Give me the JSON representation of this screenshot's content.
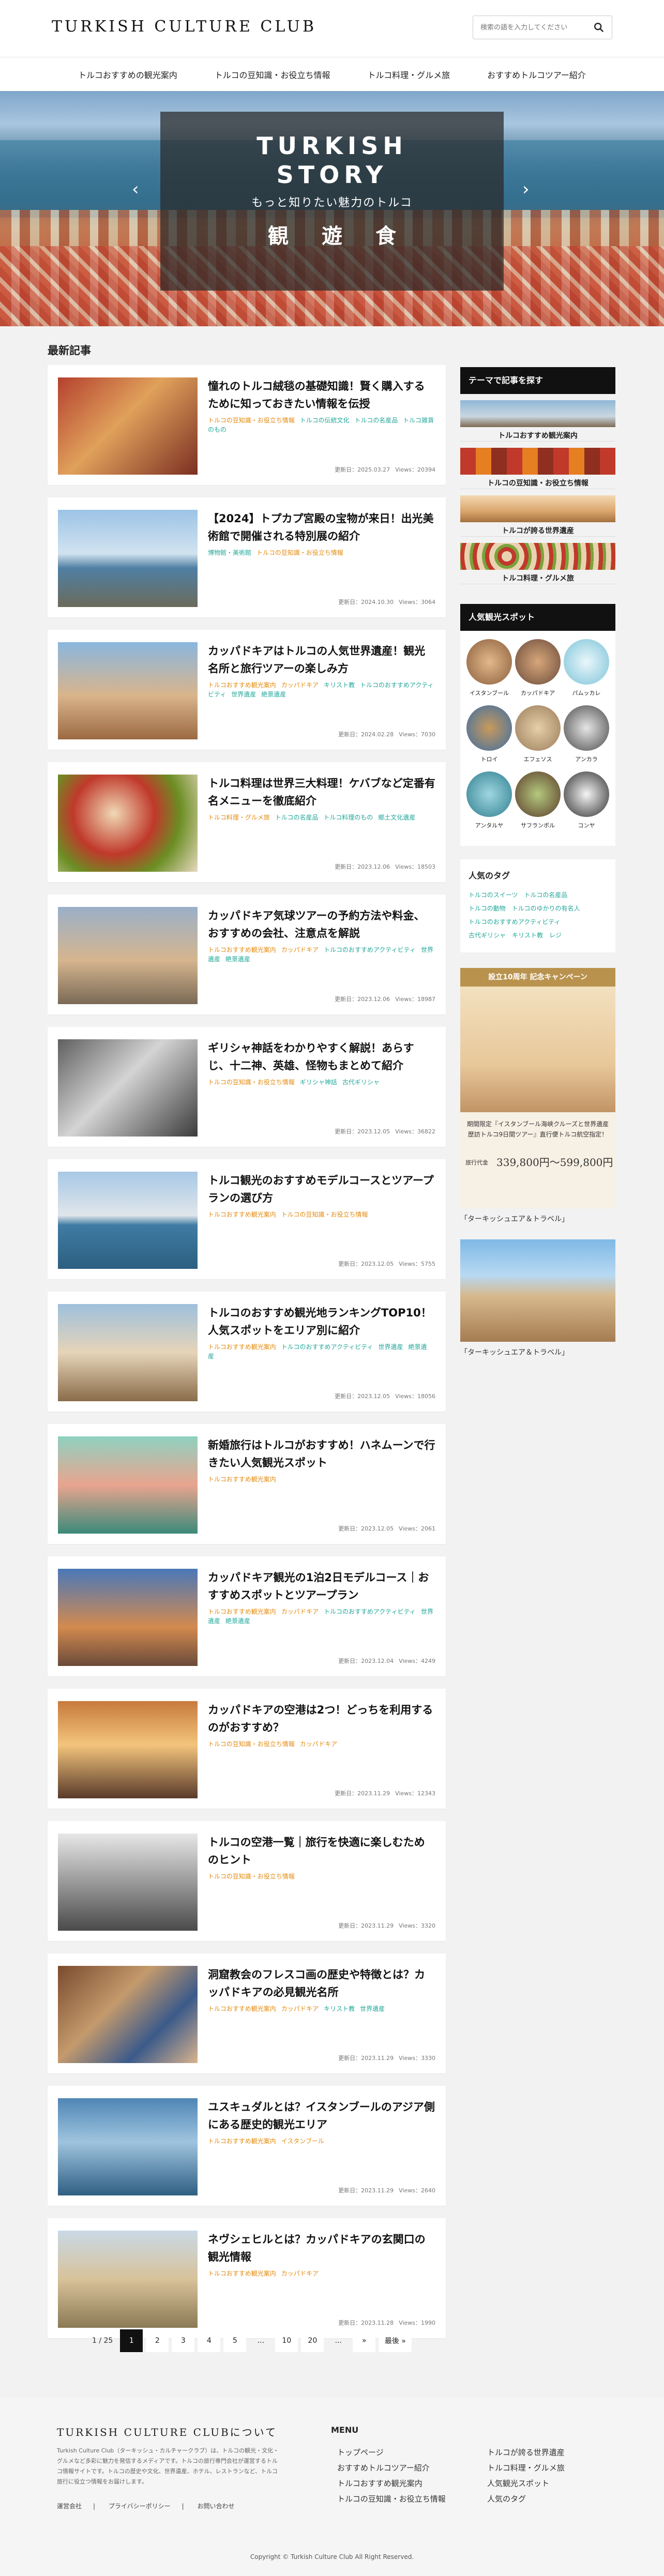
{
  "header": {
    "logo": "TURKISH CULTURE CLUB",
    "search_placeholder": "検索の語を入力してください"
  },
  "nav": [
    "トルコおすすめの観光案内",
    "トルコの豆知識・お役立ち情報",
    "トルコ料理・グルメ旅",
    "おすすめトルコツアー紹介"
  ],
  "hero": {
    "title_line1": "TURKISH",
    "title_line2": "STORY",
    "subtitle": "もっと知りたい魅力のトルコ",
    "kanji": "観遊食"
  },
  "section_title": "最新記事",
  "articles": [
    {
      "title": "憧れのトルコ絨毯の基礎知識！賢く購入するために知っておきたい情報を伝授",
      "cats_orange": [
        "トルコの豆知識・お役立ち情報"
      ],
      "cats_teal": [
        "トルコの伝統文化",
        "トルコの名産品",
        "トルコ雑貨のもの"
      ],
      "date": "2025.03.27",
      "views": "20394"
    },
    {
      "title": "【2024】トプカプ宮殿の宝物が来日！出光美術館で開催される特別展の紹介",
      "cats_orange": [],
      "cats_teal": [
        "博物館・美術館"
      ],
      "cats_orange2": [
        "トルコの豆知識・お役立ち情報"
      ],
      "date": "2024.10.30",
      "views": "3064"
    },
    {
      "title": "カッパドキアはトルコの人気世界遺産！観光名所と旅行ツアーの楽しみ方",
      "cats_orange": [
        "トルコおすすめ観光案内",
        "カッパドキア"
      ],
      "cats_teal": [
        "キリスト教",
        "トルコのおすすめアクティビティ",
        "世界遺産",
        "絶景遺産"
      ],
      "date": "2024.02.28",
      "views": "7030"
    },
    {
      "title": "トルコ料理は世界三大料理！ケバブなど定番有名メニューを徹底紹介",
      "cats_orange": [
        "トルコ料理・グルメ旅"
      ],
      "cats_teal": [
        "トルコの名産品",
        "トルコ料理のもの",
        "郷土文化遺産"
      ],
      "date": "2023.12.06",
      "views": "18503"
    },
    {
      "title": "カッパドキア気球ツアーの予約方法や料金、おすすめの会社、注意点を解説",
      "cats_orange": [
        "トルコおすすめ観光案内",
        "カッパドキア"
      ],
      "cats_teal": [
        "トルコのおすすめアクティビティ",
        "世界遺産",
        "絶景遺産"
      ],
      "date": "2023.12.06",
      "views": "18987"
    },
    {
      "title": "ギリシャ神話をわかりやすく解説！あらすじ、十二神、英雄、怪物もまとめて紹介",
      "cats_orange": [
        "トルコの豆知識・お役立ち情報"
      ],
      "cats_teal": [
        "ギリシャ神話",
        "古代ギリシャ"
      ],
      "date": "2023.12.05",
      "views": "36822"
    },
    {
      "title": "トルコ観光のおすすめモデルコースとツアープランの選び方",
      "cats_orange": [
        "トルコおすすめ観光案内",
        "トルコの豆知識・お役立ち情報"
      ],
      "cats_teal": [],
      "date": "2023.12.05",
      "views": "5755"
    },
    {
      "title": "トルコのおすすめ観光地ランキングTOP10！人気スポットをエリア別に紹介",
      "cats_orange": [
        "トルコおすすめ観光案内"
      ],
      "cats_teal": [
        "トルコのおすすめアクティビティ",
        "世界遺産",
        "絶景遺産"
      ],
      "date": "2023.12.05",
      "views": "18056"
    },
    {
      "title": "新婚旅行はトルコがおすすめ！ハネムーンで行きたい人気観光スポット",
      "cats_orange": [
        "トルコおすすめ観光案内"
      ],
      "cats_teal": [],
      "date": "2023.12.05",
      "views": "2061"
    },
    {
      "title": "カッパドキア観光の1泊2日モデルコース｜おすすめスポットとツアープラン",
      "cats_orange": [
        "トルコおすすめ観光案内",
        "カッパドキア"
      ],
      "cats_teal": [
        "トルコのおすすめアクティビティ",
        "世界遺産",
        "絶景遺産"
      ],
      "date": "2023.12.04",
      "views": "4249"
    },
    {
      "title": "カッパドキアの空港は2つ！どっちを利用するのがおすすめ？",
      "cats_orange": [
        "トルコの豆知識・お役立ち情報",
        "カッパドキア"
      ],
      "cats_teal": [],
      "date": "2023.11.29",
      "views": "12343"
    },
    {
      "title": "トルコの空港一覧｜旅行を快適に楽しむためのヒント",
      "cats_orange": [
        "トルコの豆知識・お役立ち情報"
      ],
      "cats_teal": [],
      "date": "2023.11.29",
      "views": "3320"
    },
    {
      "title": "洞窟教会のフレスコ画の歴史や特徴とは？カッパドキアの必見観光名所",
      "cats_orange": [
        "トルコおすすめ観光案内",
        "カッパドキア"
      ],
      "cats_teal": [
        "キリスト教",
        "世界遺産"
      ],
      "date": "2023.11.29",
      "views": "3330"
    },
    {
      "title": "ユスキュダルとは？イスタンブールのアジア側にある歴史的観光エリア",
      "cats_orange": [
        "トルコおすすめ観光案内",
        "イスタンブール"
      ],
      "cats_teal": [],
      "date": "2023.11.29",
      "views": "2640"
    },
    {
      "title": "ネヴシェヒルとは？カッパドキアの玄関口の観光情報",
      "cats_orange": [
        "トルコおすすめ観光案内",
        "カッパドキア"
      ],
      "cats_teal": [],
      "date": "2023.11.28",
      "views": "1990"
    }
  ],
  "meta_labels": {
    "date_prefix": "更新日：",
    "views_prefix": "Views："
  },
  "pagination": {
    "label": "1 / 25",
    "pages": [
      "1",
      "2",
      "3",
      "4",
      "5",
      "...",
      "10",
      "20",
      "...",
      "»",
      "最後 »"
    ]
  },
  "sidebar": {
    "theme_title": "テーマで記事を探す",
    "themes": [
      "トルコおすすめ観光案内",
      "トルコの豆知識・お役立ち情報",
      "トルコが誇る世界遺産",
      "トルコ料理・グルメ旅"
    ],
    "spots_title": "人気観光スポット",
    "spots": [
      "イスタンブール",
      "カッパドキア",
      "パムッカレ",
      "トロイ",
      "エフェソス",
      "アンカラ",
      "アンタルヤ",
      "サフランボル",
      "コンヤ"
    ],
    "tags_title": "人気のタグ",
    "tags": [
      [
        "トルコのスイーツ",
        "トルコの名産品"
      ],
      [
        "トルコの動物",
        "トルコのゆかりの有名人"
      ],
      [
        "トルコのおすすめアクティビティ"
      ],
      [
        "古代ギリシャ",
        "キリスト教",
        "レジ"
      ]
    ],
    "ad1_caption": "「ターキッシュエア＆トラベル」",
    "ad2_caption": "「ターキッシュエア＆トラベル」",
    "ad1": {
      "head": "設立10周年 記念キャンペーン",
      "text": "期間限定『イスタンブール海峡クルーズと世界遺産歴訪トルコ9日間ツアー』直行便トルコ航空指定！",
      "price": "339,800円〜599,800円",
      "price_label": "旅行代金"
    }
  },
  "footer": {
    "logo": "TURKISH CULTURE CLUBについて",
    "desc": "Turkish Culture Club（ターキッシュ・カルチャークラブ）は、トルコの観光・文化・グルメなど多彩に魅力を発信するメディアです。トルコの旅行専門会社が運営するトルコ情報サイトです。トルコの歴史や文化、世界遺産、ホテル、レストランなど、トルコ旅行に役立つ情報をお届けします。",
    "links": [
      "運営会社",
      "プライバシーポリシー",
      "お問い合わせ"
    ],
    "menu_title": "MENU",
    "menu_col1": [
      "トップページ",
      "おすすめトルコツアー紹介",
      "トルコおすすめ観光案内",
      "トルコの豆知識・お役立ち情報"
    ],
    "menu_col2": [
      "トルコが誇る世界遺産",
      "トルコ料理・グルメ旅",
      "人気観光スポット",
      "人気のタグ"
    ],
    "copyright": "Copyright © Turkish Culture Club All Right Reserved."
  }
}
